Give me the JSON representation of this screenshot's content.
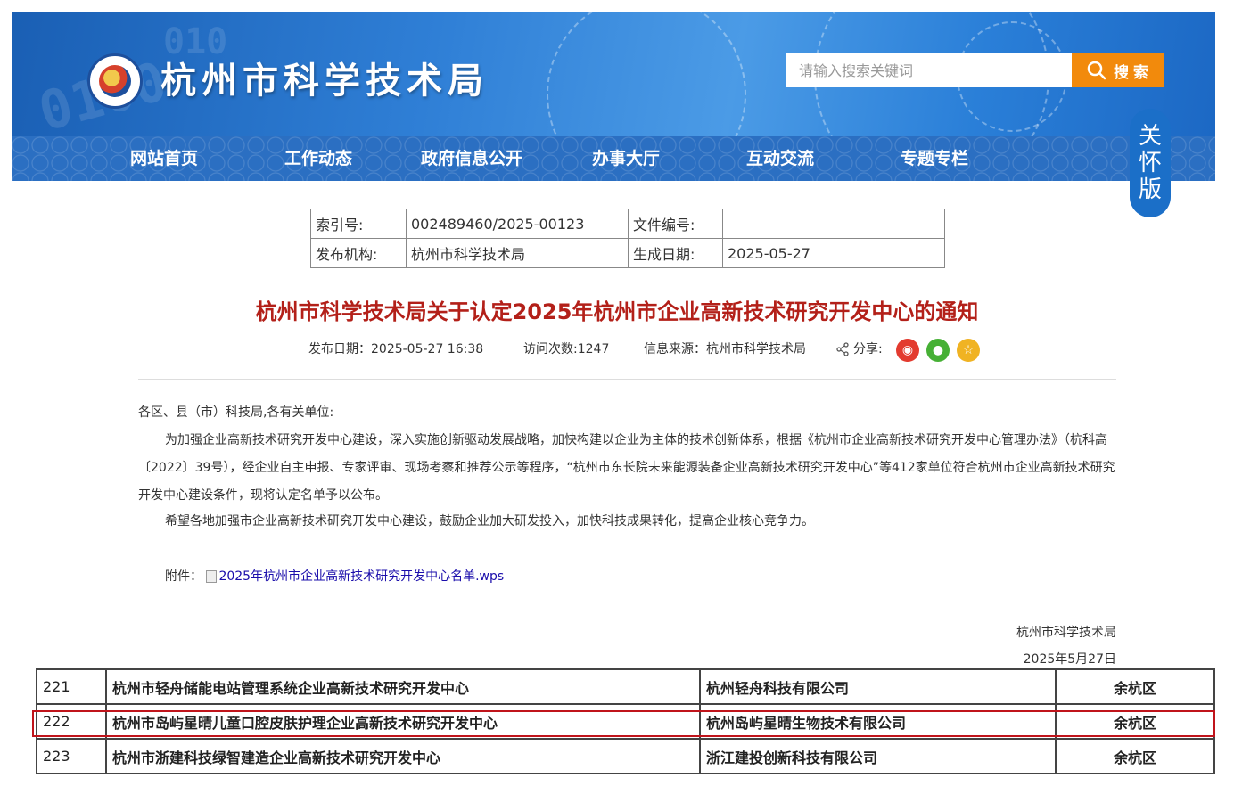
{
  "header": {
    "site_title": "杭州市科学技术局",
    "search_placeholder": "请输入搜索关键词",
    "search_button_label": "搜 索"
  },
  "nav": {
    "items": [
      "网站首页",
      "工作动态",
      "政府信息公开",
      "办事大厅",
      "互动交流",
      "专题专栏"
    ]
  },
  "care_mode": [
    "关",
    "怀",
    "版"
  ],
  "meta": {
    "index_label": "索引号:",
    "index_value": "002489460/2025-00123",
    "docno_label": "文件编号:",
    "docno_value": "",
    "publisher_label": "发布机构:",
    "publisher_value": "杭州市科学技术局",
    "date_label": "生成日期:",
    "date_value": "2025-05-27"
  },
  "article": {
    "title": "杭州市科学技术局关于认定2025年杭州市企业高新技术研究开发中心的通知",
    "publish_date": "发布日期：2025-05-27 16:38",
    "visits": "访问次数:1247",
    "source": "信息来源：杭州市科学技术局",
    "share_label": "分享:",
    "salutation": "各区、县（市）科技局,各有关单位:",
    "para1": "为加强企业高新技术研究开发中心建设，深入实施创新驱动发展战略，加快构建以企业为主体的技术创新体系，根据《杭州市企业高新技术研究开发中心管理办法》（杭科高〔2022〕39号），经企业自主申报、专家评审、现场考察和推荐公示等程序，“杭州市东长院未来能源装备企业高新技术研究开发中心”等412家单位符合杭州市企业高新技术研究开发中心建设条件，现将认定名单予以公布。",
    "para2": "希望各地加强市企业高新技术研究开发中心建设，鼓励企业加大研发投入，加快科技成果转化，提高企业核心竞争力。",
    "attachment_label": "附件：",
    "attachment_name": "2025年杭州市企业高新技术研究开发中心名单.wps",
    "signature": "杭州市科学技术局",
    "sign_date": "2025年5月27日"
  },
  "list": {
    "rows": [
      {
        "num": "221",
        "center": "杭州市轻舟储能电站管理系统企业高新技术研究开发中心",
        "company": "杭州轻舟科技有限公司",
        "district": "余杭区"
      },
      {
        "num": "222",
        "center": "杭州市岛屿星晴儿童口腔皮肤护理企业高新技术研究开发中心",
        "company": "杭州岛屿星晴生物技术有限公司",
        "district": "余杭区"
      },
      {
        "num": "223",
        "center": "杭州市浙建科技绿智建造企业高新技术研究开发中心",
        "company": "浙江建投创新科技有限公司",
        "district": "余杭区"
      }
    ]
  },
  "colors": {
    "title_red": "#b32019",
    "nav_blue": "#2b6fc2",
    "search_orange": "#f28a0c",
    "highlight_red": "#c0141b"
  },
  "icons": {
    "search": "search-icon",
    "share": "share-icon",
    "weibo": "weibo-icon",
    "wechat": "wechat-icon",
    "favorite": "star-icon"
  }
}
